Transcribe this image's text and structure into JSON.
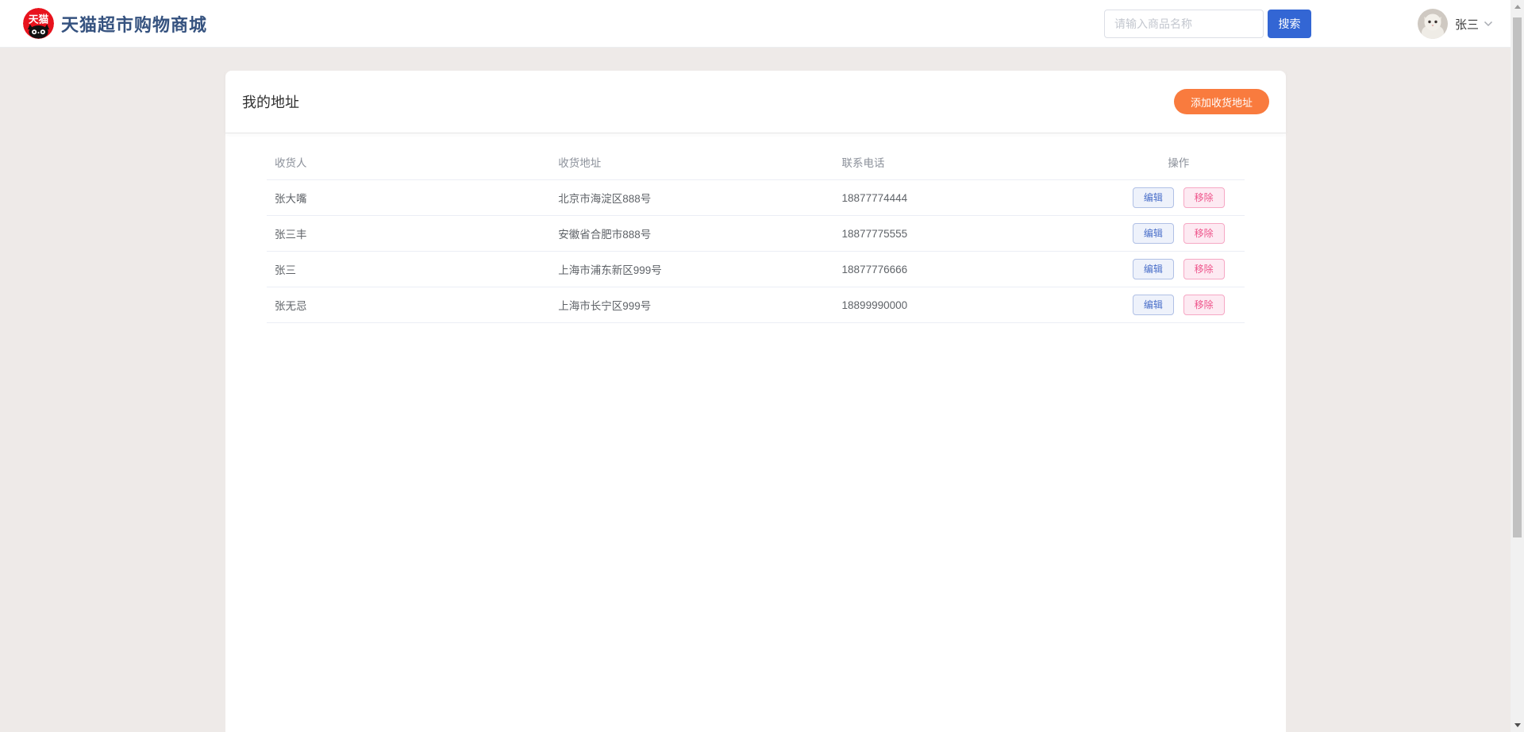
{
  "header": {
    "logo": {
      "text": "天猫",
      "eyes": "0.0"
    },
    "title": "天猫超市购物商城",
    "search": {
      "placeholder": "请输入商品名称",
      "button_label": "搜索"
    },
    "user": {
      "name": "张三"
    }
  },
  "page": {
    "card_title": "我的地址",
    "add_button_label": "添加收货地址"
  },
  "table": {
    "columns": [
      "收货人",
      "收货地址",
      "联系电话",
      "操作"
    ],
    "rows": [
      {
        "name": "张大嘴",
        "address": "北京市海淀区888号",
        "phone": "18877774444"
      },
      {
        "name": "张三丰",
        "address": "安徽省合肥市888号",
        "phone": "18877775555"
      },
      {
        "name": "张三",
        "address": "上海市浦东新区999号",
        "phone": "18877776666"
      },
      {
        "name": "张无忌",
        "address": "上海市长宁区999号",
        "phone": "18899990000"
      }
    ],
    "actions": {
      "edit_label": "编辑",
      "remove_label": "移除"
    }
  },
  "colors": {
    "page_background": "#eeeae8",
    "brand_title": "#35527f",
    "logo_red": "#e8131d",
    "primary_blue": "#3366d4",
    "accent_orange": "#f97b3e",
    "edit_text": "#4a6fc9",
    "remove_text": "#ee538a"
  }
}
